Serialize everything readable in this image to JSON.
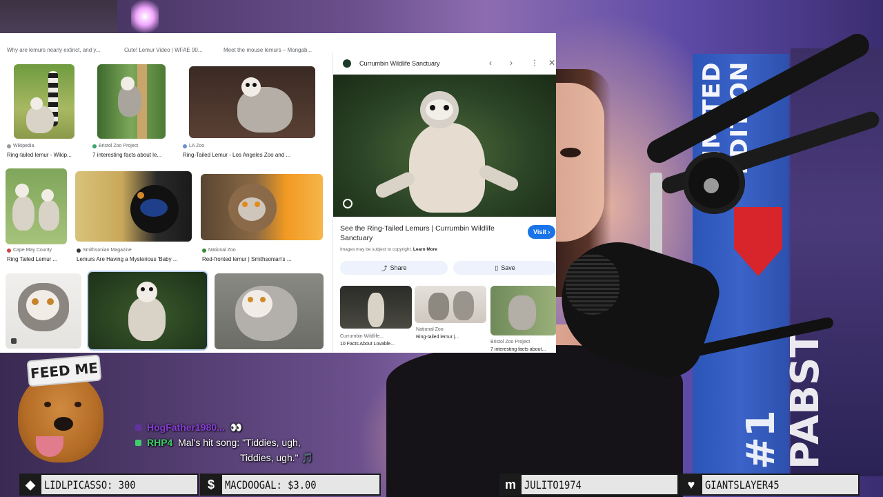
{
  "search_suggestions": [
    "Why are lemurs nearly extinct, and y...",
    "Cute! Lemur Video | WFAE 90...",
    "Meet the mouse lemurs – Mongab..."
  ],
  "results": {
    "row1": [
      {
        "source": "Wikipedia",
        "caption": "Ring-tailed lemur - Wikip..."
      },
      {
        "source": "Bristol Zoo Project",
        "caption": "7 interesting facts about le..."
      },
      {
        "source": "LA Zoo",
        "caption": "Ring-Tailed Lemur - Los Angeles Zoo and ..."
      }
    ],
    "row2": [
      {
        "source": "Cape May County",
        "caption": "Ring Tailed Lemur ..."
      },
      {
        "source": "Smithsonian Magazine",
        "caption": "Lemurs Are Having a Mysterious 'Baby ..."
      },
      {
        "source": "National Zoo",
        "caption": "Red-fronted lemur | Smithsonian's ..."
      }
    ]
  },
  "panel": {
    "site": "Currumbin Wildlife Sanctuary",
    "title": "See the Ring-Tailed Lemurs | Currumbin Wildlife Sanctuary",
    "visit": "Visit",
    "copyright": "Images may be subject to copyright.",
    "learn_more": "Learn More",
    "share": "Share",
    "save": "Save",
    "related": [
      {
        "source": "Currumbin Wildlife...",
        "caption": "10 Facts About Lovable..."
      },
      {
        "source": "National Zoo",
        "caption": "Ring-tailed lemur |..."
      },
      {
        "source": "Bristol Zoo Project",
        "caption": "7 interesting facts about..."
      }
    ]
  },
  "overlay": {
    "dog_hat": "FEED ME",
    "box_top": "LIMITED EDITION",
    "box_bottom": "#1 PABST"
  },
  "chat": [
    {
      "user": "HogFather1980...",
      "message": "👀"
    },
    {
      "user": "RHP4",
      "message": "Mal's hit song: \"Tiddies, ugh,",
      "message_cont": "Tiddies, ugh.\" 🎵"
    }
  ],
  "bottom_bar": [
    {
      "icon": "diamond-icon",
      "text": "LIDLPICASSO: 300"
    },
    {
      "icon": "dollar-icon",
      "text": "MACDOOGAL: $3.00"
    },
    {
      "icon": "m-icon",
      "text": "JULITO1974"
    },
    {
      "icon": "heart-icon",
      "text": "GIANTSLAYER45"
    }
  ],
  "colors": {
    "accent_blue": "#1a73e8",
    "chat_user_1": "#8f3ee6",
    "chat_user_2": "#3ecf6a"
  }
}
